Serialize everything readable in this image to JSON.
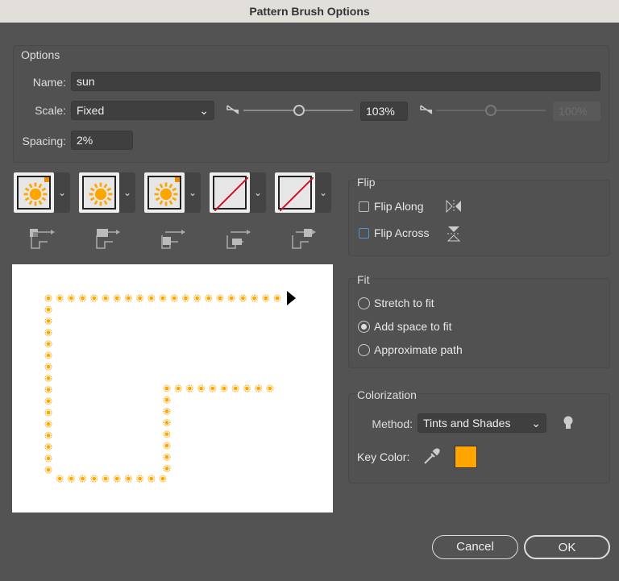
{
  "title": "Pattern Brush Options",
  "options": {
    "group_label": "Options",
    "name_label": "Name:",
    "name_value": "sun",
    "scale_label": "Scale:",
    "scale_value": "Fixed",
    "scale_percent": "103%",
    "scale_percent2": "100%",
    "scale_slider_value": 103,
    "spacing_label": "Spacing:",
    "spacing_value": "2%"
  },
  "tiles": [
    {
      "name": "outer-corner-tile",
      "icon": "sun"
    },
    {
      "name": "side-tile",
      "icon": "sun"
    },
    {
      "name": "inner-corner-tile",
      "icon": "sun"
    },
    {
      "name": "start-tile",
      "icon": "none"
    },
    {
      "name": "end-tile",
      "icon": "none"
    }
  ],
  "flip": {
    "group_label": "Flip",
    "along_label": "Flip Along",
    "across_label": "Flip Across",
    "along_checked": false,
    "across_checked": false
  },
  "fit": {
    "group_label": "Fit",
    "options": [
      "Stretch to fit",
      "Add space to fit",
      "Approximate path"
    ],
    "selected": 1
  },
  "colorization": {
    "group_label": "Colorization",
    "method_label": "Method:",
    "method_value": "Tints and Shades",
    "key_color_label": "Key Color:",
    "key_color": "#FFA500"
  },
  "buttons": {
    "cancel": "Cancel",
    "ok": "OK"
  },
  "colors": {
    "sun": "#FFA500",
    "bg": "#535353"
  }
}
